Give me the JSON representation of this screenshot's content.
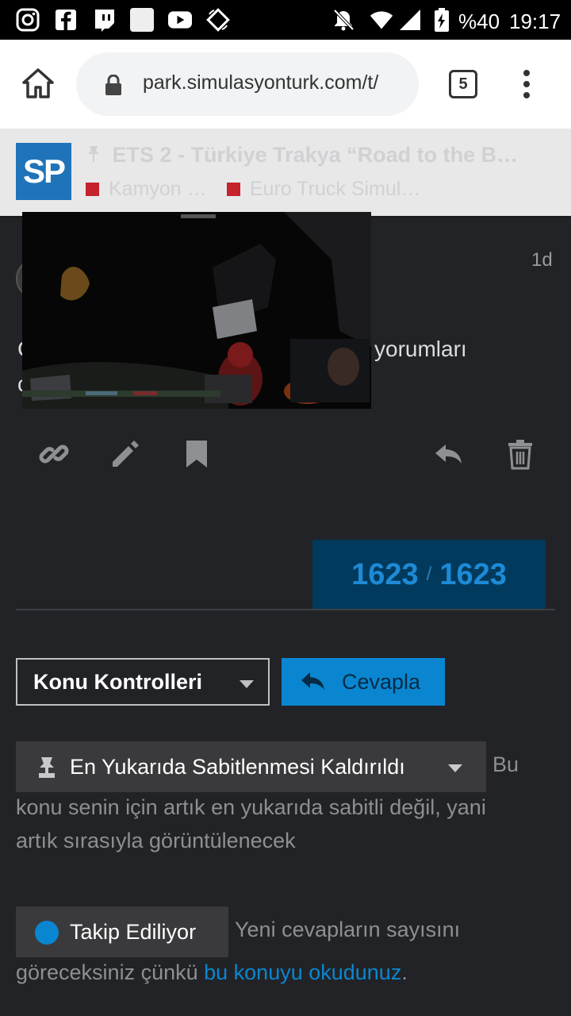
{
  "status_bar": {
    "battery": "%40",
    "time": "19:17",
    "icons": [
      "instagram-icon",
      "facebook-icon",
      "twitch-icon",
      "blank-app-icon",
      "youtube-icon",
      "rotate-icon",
      "bell-off-icon",
      "wifi-icon",
      "signal-icon",
      "battery-icon"
    ]
  },
  "browser": {
    "url": "park.simulasyonturk.com/t/",
    "tab_count": "5"
  },
  "topic_header": {
    "logo": "SP",
    "title": "ETS 2 - Türkiye Trakya “Road to the B…",
    "categories": [
      "Kamyon …",
      "Euro Truck Simul…"
    ],
    "category_color": "#c5222c"
  },
  "post": {
    "date": "1d",
    "text_fragment_left": "C",
    "text_fragment_left2": "c",
    "text_fragment_right": "yorumları"
  },
  "progress": {
    "current": "1623",
    "separator": "/",
    "total": "1623"
  },
  "controls": {
    "topic_controls_label": "Konu Kontrolleri",
    "reply_label": "Cevapla"
  },
  "notifications": {
    "pin": {
      "label": "En Yukarıda Sabitlenmesi Kaldırıldı",
      "desc_inline": "Bu",
      "desc_line2": "konu senin için artık en yukarıda sabitli değil, yani",
      "desc_line3": "artık sırasıyla görüntülenecek"
    },
    "tracking": {
      "label": "Takip Ediliyor",
      "desc_inline": "Yeni cevapların sayısını",
      "desc_line2_prefix": "göreceksiniz çünkü ",
      "desc_link": "bu konuyu okudunuz",
      "desc_line2_suffix": "."
    }
  },
  "colors": {
    "accent": "#0a86d0",
    "background": "#222326",
    "progress_bg": "#013a5c"
  }
}
